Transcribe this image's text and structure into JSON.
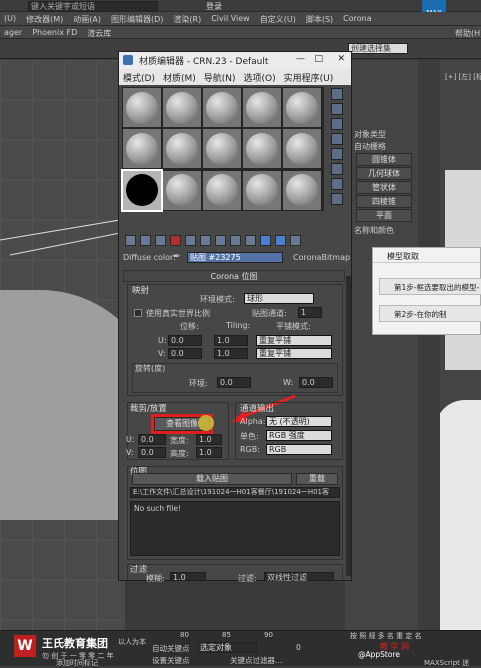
{
  "app": {
    "search_placeholder": "键入关键字或短语",
    "login_label": "登录",
    "user_badge": "MAX"
  },
  "main_menu": [
    "(U)",
    "修改器(M)",
    "动画(A)",
    "图形编辑器(D)",
    "渲染(R)",
    "Civil View",
    "自定义(U)",
    "脚本(S)",
    "Corona"
  ],
  "sub_menu": [
    "ager",
    "Phoenix FD",
    "渲云库"
  ],
  "right_menu": [
    "帮助(H)"
  ],
  "right_selection": "创建选择集",
  "viewport_label": "[+] [左] [标准] [默认明暗处理]",
  "dialog": {
    "title": "材质编辑器 - CRN.23 - Default",
    "menu": [
      "模式(D)",
      "材质(M)",
      "导航(N)",
      "选项(O)",
      "实用程序(U)"
    ],
    "diffuse_label": "Diffuse color:",
    "map_name": "贴图 #23275",
    "map_type": "CoronaBitmap",
    "rollout_title": "Corona 位图",
    "mapping": {
      "title": "映射",
      "env_mode_label": "环境模式:",
      "env_mode_value": "球形",
      "real_world_label": "使用真实世界比例",
      "map_channel_label": "贴图通道:",
      "map_channel_value": "1",
      "offset_label": "位移:",
      "tiling_label": "Tiling:",
      "tile_mode_label": "平铺模式:",
      "u_label": "U:",
      "u_offset": "0.0",
      "u_tiling": "1.0",
      "u_mode": "重复平铺",
      "v_label": "V:",
      "v_offset": "0.0",
      "v_tiling": "1.0",
      "v_mode": "重复平铺",
      "rotation_title": "旋转(度)",
      "env_label": "环境:",
      "env_value": "0.0",
      "w_label": "W:",
      "w_value": "0.0"
    },
    "crop": {
      "title": "裁剪/放置",
      "view_image_label": "查看图像",
      "u_label": "U:",
      "u_value": "0.0",
      "w_label": "宽度:",
      "w_value": "1.0",
      "v_label": "V:",
      "v_value": "0.0",
      "h_label": "高度:",
      "h_value": "1.0"
    },
    "channel_output": {
      "title": "通道输出",
      "alpha_label": "Alpha:",
      "alpha_value": "无 (不透明)",
      "mono_label": "单色:",
      "mono_value": "RGB 强度",
      "rgb_label": "RGB:",
      "rgb_value": "RGB"
    },
    "bitmap": {
      "title": "位图",
      "load_label": "载入贴图",
      "reload_label": "重载",
      "path": "E:\\工作文件\\汇总设计\\191024一H01客餐厅\\191024一H01客",
      "status": "No such file!"
    },
    "filter": {
      "title": "过滤",
      "left_label": "模糊:",
      "left_value": "1.0",
      "right_label": "过滤:",
      "right_value": "双线性过滤"
    }
  },
  "command_panel": {
    "object_type": "对象类型",
    "auto_grid": "自动栅格",
    "items": [
      "圆锥体",
      "几何球体",
      "管状体",
      "四棱锥",
      "平面"
    ],
    "name_color": "名称和颜色"
  },
  "popup": {
    "title": "模型取取",
    "step1": "第1步-框选要取出的模型-",
    "step2": "第2步-在你的制"
  },
  "status_bar": {
    "brand": "王氏教育集团",
    "brand_tag": "以人为本",
    "brand_sub": "勿 创 于 一 零 零 二 年",
    "frame_80": "80",
    "frame_85": "85",
    "frame_90": "90",
    "auto_key": "自动关键点",
    "selected_obj": "选定对象",
    "set_key": "设置关键点",
    "key_filter": "关键点过滤器...",
    "add_time": "添加时间标记",
    "counter": "0",
    "right_text": "按 照 规 多 名 重 定 名",
    "appstore": "@AppStore",
    "maxscript": "MAXScript 迷",
    "jiaxue": "教 学 网",
    "small": "ⓘ 公众号"
  }
}
